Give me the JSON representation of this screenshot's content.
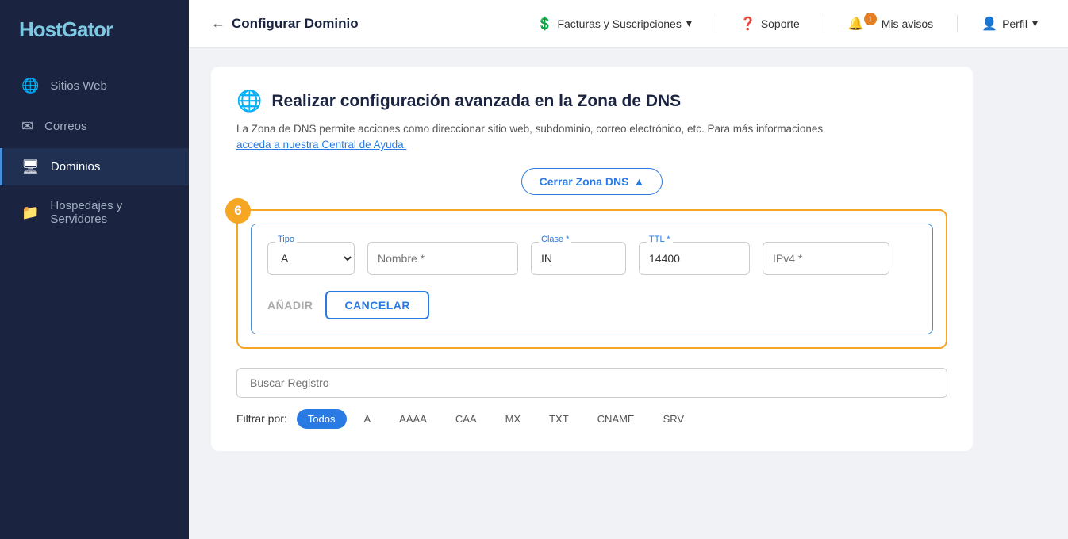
{
  "brand": {
    "name_part1": "Host",
    "name_part2": "Gator"
  },
  "sidebar": {
    "items": [
      {
        "id": "sitios-web",
        "label": "Sitios Web",
        "icon": "🌐",
        "active": false
      },
      {
        "id": "correos",
        "label": "Correos",
        "icon": "✉",
        "active": false
      },
      {
        "id": "dominios",
        "label": "Dominios",
        "icon": "🖥",
        "active": true
      },
      {
        "id": "hospedajes",
        "label": "Hospedajes y Servidores",
        "icon": "📁",
        "active": false
      }
    ]
  },
  "topbar": {
    "back_arrow": "←",
    "page_title": "Configurar Dominio",
    "facturas_label": "Facturas y Suscripciones",
    "soporte_label": "Soporte",
    "avisos_label": "Mis avisos",
    "perfil_label": "Perfil",
    "avisos_badge": "1"
  },
  "section": {
    "icon": "🌐",
    "title": "Realizar configuración avanzada en la Zona de DNS",
    "description": "La Zona de DNS permite acciones como direccionar sitio web, subdominio, correo electrónico, etc. Para más informaciones",
    "help_link_text": "acceda a nuestra Central de Ayuda.",
    "cerrar_btn": "Cerrar Zona DNS"
  },
  "step_box": {
    "number": "6"
  },
  "dns_form": {
    "tipo_label": "Tipo",
    "tipo_value": "A",
    "nombre_label": "Nombre *",
    "clase_label": "Clase *",
    "clase_value": "IN",
    "ttl_label": "TTL *",
    "ttl_value": "14400",
    "ipv4_label": "IPv4 *",
    "anadir_btn": "AÑADIR",
    "cancelar_btn": "CANCELAR"
  },
  "search": {
    "placeholder": "Buscar Registro"
  },
  "filters": {
    "label": "Filtrar por:",
    "items": [
      {
        "id": "todos",
        "label": "Todos",
        "active": true
      },
      {
        "id": "a",
        "label": "A",
        "active": false
      },
      {
        "id": "aaaa",
        "label": "AAAA",
        "active": false
      },
      {
        "id": "caa",
        "label": "CAA",
        "active": false
      },
      {
        "id": "mx",
        "label": "MX",
        "active": false
      },
      {
        "id": "txt",
        "label": "TXT",
        "active": false
      },
      {
        "id": "cname",
        "label": "CNAME",
        "active": false
      },
      {
        "id": "srv",
        "label": "SRV",
        "active": false
      }
    ]
  }
}
